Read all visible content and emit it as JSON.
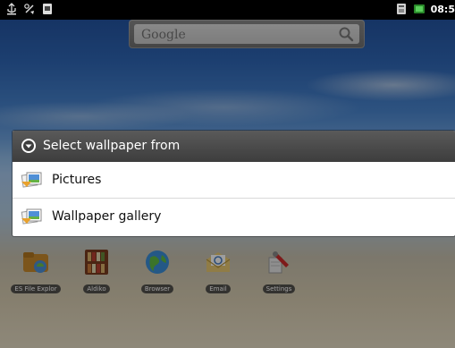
{
  "status_bar": {
    "time": "08:5",
    "left_icons": [
      "usb-icon",
      "debug-icon",
      "sdcard-icon"
    ],
    "right_icons": [
      "sim-icon",
      "battery-icon"
    ]
  },
  "search_widget": {
    "placeholder": "Google",
    "icon": "search-icon"
  },
  "dialog": {
    "title": "Select wallpaper from",
    "items": [
      {
        "label": "Pictures",
        "icon": "pictures-icon"
      },
      {
        "label": "Wallpaper gallery",
        "icon": "wallpaper-gallery-icon"
      }
    ]
  },
  "home_apps": [
    {
      "label": "ES File Explor",
      "icon": "folder-icon"
    },
    {
      "label": "Aldiko",
      "icon": "bookshelf-icon"
    },
    {
      "label": "Browser",
      "icon": "globe-icon"
    },
    {
      "label": "Email",
      "icon": "email-icon"
    },
    {
      "label": "Settings",
      "icon": "settings-icon"
    }
  ],
  "colors": {
    "dialog_title_bg": "#454545",
    "dialog_bg": "#ffffff",
    "status_bar_bg": "#000000"
  }
}
